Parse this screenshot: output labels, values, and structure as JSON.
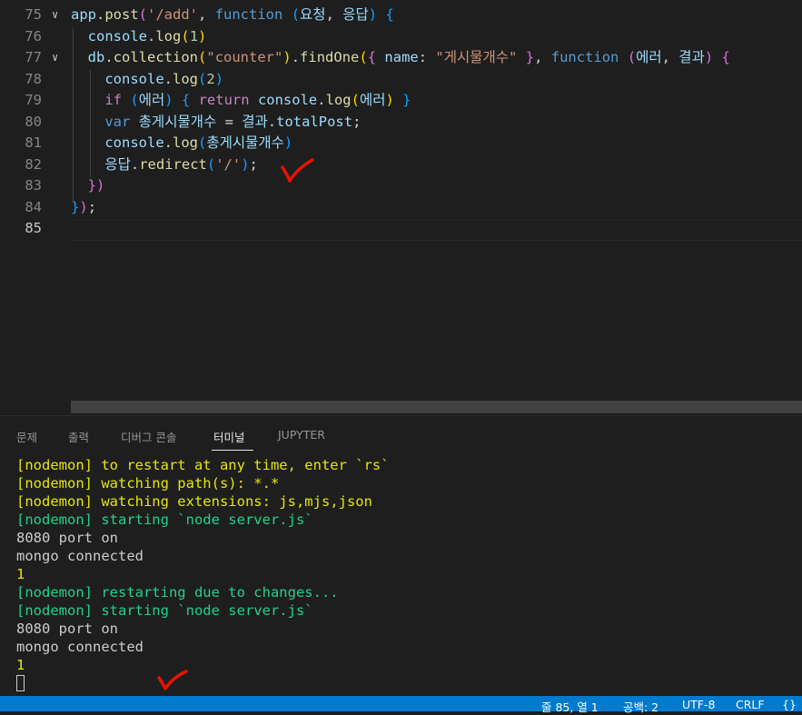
{
  "editor": {
    "lines": [
      {
        "n": "75",
        "fold": "∨",
        "tokens": [
          {
            "t": "app",
            "c": "t-var"
          },
          {
            "t": ".",
            "c": "t-p"
          },
          {
            "t": "post",
            "c": "t-fn"
          },
          {
            "t": "(",
            "c": "t-b2"
          },
          {
            "t": "'/add'",
            "c": "t-str"
          },
          {
            "t": ", ",
            "c": "t-p"
          },
          {
            "t": "function",
            "c": "t-kw"
          },
          {
            "t": " ",
            "c": "t-p"
          },
          {
            "t": "(",
            "c": "t-b3"
          },
          {
            "t": "요청",
            "c": "t-var"
          },
          {
            "t": ", ",
            "c": "t-p"
          },
          {
            "t": "응답",
            "c": "t-var"
          },
          {
            "t": ")",
            "c": "t-b3"
          },
          {
            "t": " ",
            "c": "t-p"
          },
          {
            "t": "{",
            "c": "t-b3"
          }
        ]
      },
      {
        "n": "76",
        "fold": "",
        "tokens": [
          {
            "t": "  ",
            "c": "t-p"
          },
          {
            "t": "console",
            "c": "t-var"
          },
          {
            "t": ".",
            "c": "t-p"
          },
          {
            "t": "log",
            "c": "t-fn"
          },
          {
            "t": "(",
            "c": "t-b1"
          },
          {
            "t": "1",
            "c": "t-num"
          },
          {
            "t": ")",
            "c": "t-b1"
          }
        ]
      },
      {
        "n": "77",
        "fold": "∨",
        "tokens": [
          {
            "t": "  ",
            "c": "t-p"
          },
          {
            "t": "db",
            "c": "t-var"
          },
          {
            "t": ".",
            "c": "t-p"
          },
          {
            "t": "collection",
            "c": "t-fn"
          },
          {
            "t": "(",
            "c": "t-b1"
          },
          {
            "t": "\"counter\"",
            "c": "t-str"
          },
          {
            "t": ")",
            "c": "t-b1"
          },
          {
            "t": ".",
            "c": "t-p"
          },
          {
            "t": "findOne",
            "c": "t-fn"
          },
          {
            "t": "(",
            "c": "t-b1"
          },
          {
            "t": "{",
            "c": "t-b2"
          },
          {
            "t": " ",
            "c": "t-p"
          },
          {
            "t": "name",
            "c": "t-var"
          },
          {
            "t": ": ",
            "c": "t-p"
          },
          {
            "t": "\"게시물개수\"",
            "c": "t-str"
          },
          {
            "t": " ",
            "c": "t-p"
          },
          {
            "t": "}",
            "c": "t-b2"
          },
          {
            "t": ", ",
            "c": "t-p"
          },
          {
            "t": "function",
            "c": "t-kw"
          },
          {
            "t": " ",
            "c": "t-p"
          },
          {
            "t": "(",
            "c": "t-b2"
          },
          {
            "t": "에러",
            "c": "t-var"
          },
          {
            "t": ", ",
            "c": "t-p"
          },
          {
            "t": "결과",
            "c": "t-var"
          },
          {
            "t": ")",
            "c": "t-b2"
          },
          {
            "t": " ",
            "c": "t-p"
          },
          {
            "t": "{",
            "c": "t-b2"
          }
        ]
      },
      {
        "n": "78",
        "fold": "",
        "tokens": [
          {
            "t": "    ",
            "c": "t-p"
          },
          {
            "t": "console",
            "c": "t-var"
          },
          {
            "t": ".",
            "c": "t-p"
          },
          {
            "t": "log",
            "c": "t-fn"
          },
          {
            "t": "(",
            "c": "t-b3"
          },
          {
            "t": "2",
            "c": "t-num"
          },
          {
            "t": ")",
            "c": "t-b3"
          }
        ]
      },
      {
        "n": "79",
        "fold": "",
        "tokens": [
          {
            "t": "    ",
            "c": "t-p"
          },
          {
            "t": "if",
            "c": "t-ctl"
          },
          {
            "t": " ",
            "c": "t-p"
          },
          {
            "t": "(",
            "c": "t-b3"
          },
          {
            "t": "에러",
            "c": "t-var"
          },
          {
            "t": ")",
            "c": "t-b3"
          },
          {
            "t": " ",
            "c": "t-p"
          },
          {
            "t": "{",
            "c": "t-b3"
          },
          {
            "t": " ",
            "c": "t-p"
          },
          {
            "t": "return",
            "c": "t-ctl"
          },
          {
            "t": " ",
            "c": "t-p"
          },
          {
            "t": "console",
            "c": "t-var"
          },
          {
            "t": ".",
            "c": "t-p"
          },
          {
            "t": "log",
            "c": "t-fn"
          },
          {
            "t": "(",
            "c": "t-b1"
          },
          {
            "t": "에러",
            "c": "t-var"
          },
          {
            "t": ")",
            "c": "t-b1"
          },
          {
            "t": " ",
            "c": "t-p"
          },
          {
            "t": "}",
            "c": "t-b3"
          }
        ]
      },
      {
        "n": "80",
        "fold": "",
        "tokens": [
          {
            "t": "    ",
            "c": "t-p"
          },
          {
            "t": "var",
            "c": "t-kw"
          },
          {
            "t": " ",
            "c": "t-p"
          },
          {
            "t": "총게시물개수",
            "c": "t-var"
          },
          {
            "t": " = ",
            "c": "t-p"
          },
          {
            "t": "결과",
            "c": "t-var"
          },
          {
            "t": ".",
            "c": "t-p"
          },
          {
            "t": "totalPost",
            "c": "t-var"
          },
          {
            "t": ";",
            "c": "t-p"
          }
        ]
      },
      {
        "n": "81",
        "fold": "",
        "tokens": [
          {
            "t": "    ",
            "c": "t-p"
          },
          {
            "t": "console",
            "c": "t-var"
          },
          {
            "t": ".",
            "c": "t-p"
          },
          {
            "t": "log",
            "c": "t-fn"
          },
          {
            "t": "(",
            "c": "t-b3"
          },
          {
            "t": "총게시물개수",
            "c": "t-var"
          },
          {
            "t": ")",
            "c": "t-b3"
          }
        ]
      },
      {
        "n": "82",
        "fold": "",
        "tokens": [
          {
            "t": "    ",
            "c": "t-p"
          },
          {
            "t": "응답",
            "c": "t-var"
          },
          {
            "t": ".",
            "c": "t-p"
          },
          {
            "t": "redirect",
            "c": "t-fn"
          },
          {
            "t": "(",
            "c": "t-b3"
          },
          {
            "t": "'/'",
            "c": "t-str"
          },
          {
            "t": ")",
            "c": "t-b3"
          },
          {
            "t": ";",
            "c": "t-p"
          }
        ]
      },
      {
        "n": "83",
        "fold": "",
        "tokens": [
          {
            "t": "  ",
            "c": "t-p"
          },
          {
            "t": "})",
            "c": "t-b2"
          }
        ]
      },
      {
        "n": "84",
        "fold": "",
        "tokens": [
          {
            "t": "}",
            "c": "t-b3"
          },
          {
            "t": ")",
            "c": "t-b2"
          },
          {
            "t": ";",
            "c": "t-p"
          }
        ]
      },
      {
        "n": "85",
        "fold": "",
        "tokens": []
      }
    ]
  },
  "panel": {
    "tabs": [
      {
        "label": "문제"
      },
      {
        "label": "출력"
      },
      {
        "label": "디버그 콘솔"
      },
      {
        "label": "터미널"
      },
      {
        "label": "JUPYTER"
      }
    ],
    "active_tab": "터미널",
    "terminal": [
      {
        "text": "[nodemon] to restart at any time, enter `rs`",
        "c": "y"
      },
      {
        "text": "[nodemon] watching path(s): *.*",
        "c": "y"
      },
      {
        "text": "[nodemon] watching extensions: js,mjs,json",
        "c": "y"
      },
      {
        "text": "[nodemon] starting `node server.js`",
        "c": "g"
      },
      {
        "text": "8080 port on",
        "c": "w"
      },
      {
        "text": "mongo connected",
        "c": "w"
      },
      {
        "text": "1",
        "c": "y"
      },
      {
        "text": "[nodemon] restarting due to changes...",
        "c": "g"
      },
      {
        "text": "[nodemon] starting `node server.js`",
        "c": "g"
      },
      {
        "text": "8080 port on",
        "c": "w"
      },
      {
        "text": "mongo connected",
        "c": "w"
      },
      {
        "text": "1",
        "c": "y"
      }
    ]
  },
  "status": {
    "position": "줄 85, 열 1",
    "indent": "공백: 2",
    "encoding": "UTF-8",
    "eol": "CRLF",
    "language_icon": "{}"
  },
  "colors": {
    "accent": "#007acc",
    "annotation": "#e51400"
  }
}
